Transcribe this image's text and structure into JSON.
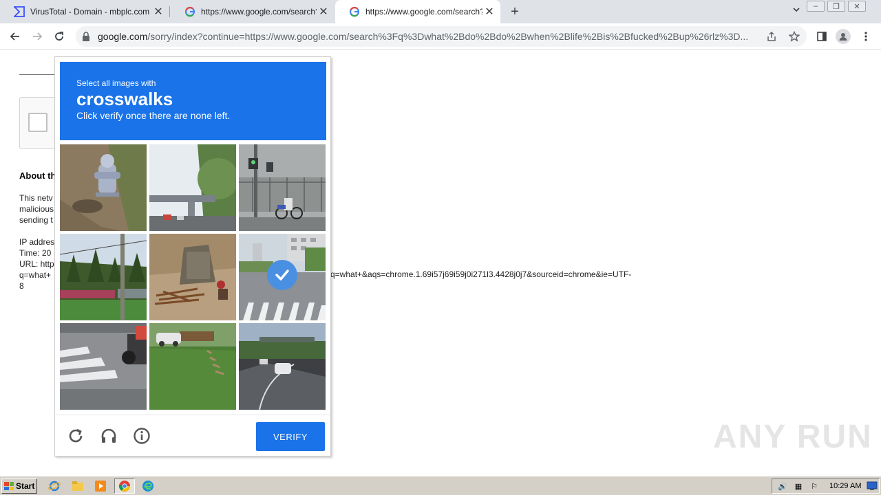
{
  "tabs": [
    {
      "title": "VirusTotal - Domain - mbplc.com",
      "favicon": "virustotal-icon"
    },
    {
      "title": "https://www.google.com/search?q=",
      "favicon": "google-icon"
    },
    {
      "title": "https://www.google.com/search?q=",
      "favicon": "google-icon"
    }
  ],
  "toolbar": {
    "url_host": "google.com",
    "url_path": "/sorry/index?continue=https://www.google.com/search%3Fq%3Dwhat%2Bdo%2Bdo%2Bwhen%2Blife%2Bis%2Bfucked%2Bup%26rlz%3D..."
  },
  "page": {
    "about": "About th",
    "line1": "This netv",
    "line2": "malicious",
    "line3": "sending t",
    "ip": "IP addres",
    "time": "Time: 20",
    "url": "URL: http",
    "q": "q=what+",
    "eight": "8",
    "url_tail": "q=what+&aqs=chrome.1.69i57j69i59j0i271l3.4428j0j7&sourceid=chrome&ie=UTF-"
  },
  "captcha": {
    "instruction": "Select all images with",
    "target": "crosswalks",
    "hint": "Click verify once there are none left.",
    "verify_label": "VERIFY",
    "selected_tile": 5
  },
  "watermark": "ANY RUN",
  "taskbar": {
    "start_label": "Start",
    "clock": "10:29 AM"
  },
  "colors": {
    "captcha_blue": "#1a73e8",
    "check_blue": "#4a90e2"
  }
}
